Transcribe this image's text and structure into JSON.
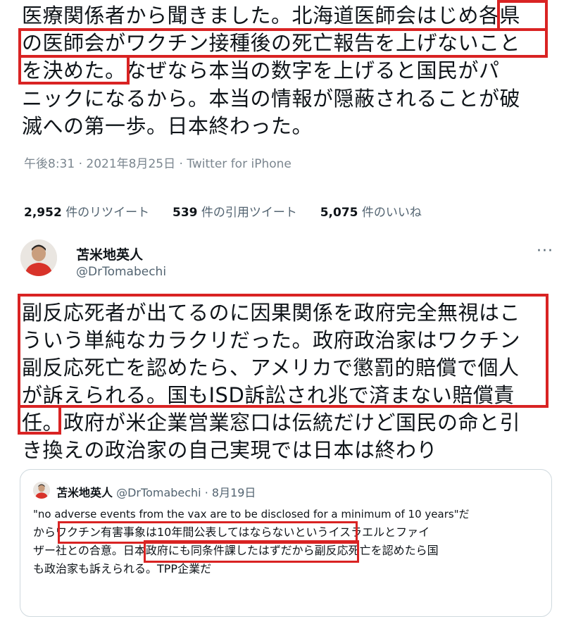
{
  "tweet1": {
    "lines": [
      "医療関係者から聞きました。北海道医師会はじめ各県",
      "の医師会がワクチン接種後の死亡報告を上げないこと",
      "を決めた。なぜなら本当の数字を上げると国民がパ",
      "ニックになるから。本当の情報が隠蔽されることが破",
      "滅への第一歩。日本終わった。"
    ],
    "meta": "午後8:31 · 2021年8月25日 · Twitter for iPhone",
    "stats": [
      {
        "count": "2,952",
        "label": "件のリツイート"
      },
      {
        "count": "539",
        "label": "件の引用ツイート"
      },
      {
        "count": "5,075",
        "label": "件のいいね"
      }
    ]
  },
  "tweet2": {
    "author_name": "苫米地英人",
    "author_handle": "@DrTomabechi",
    "more_icon": "···",
    "lines": [
      "副反応死者が出てるのに因果関係を政府完全無視はこ",
      "ういう単純なカラクリだった。政府政治家はワクチン",
      "副反応死亡を認めたら、アメリカで懲罰的賠償で個人",
      "が訴えられる。国もISD訴訟され兆で済まない賠償責",
      "任。政府が米企業営業窓口は伝統だけど国民の命と引",
      "き換えの政治家の自己実現では日本は終わり"
    ]
  },
  "quote": {
    "author_name": "苫米地英人",
    "author_handle": "@DrTomabechi",
    "date": "· 8月19日",
    "lines": [
      "\"no adverse events from the vax are to be disclosed for a minimum of 10 years\"だ",
      "からワクチン有害事象は10年間公表してはならないというイスラエルとファイ",
      "ザー社との合意。日本政府にも同条件課したはずだから副反応死亡を認めたら国",
      "も政治家も訴えられる。TPP企業だ"
    ]
  },
  "colors": {
    "highlight": "#d92323",
    "meta": "#7b868f",
    "border": "#cfd9de"
  }
}
